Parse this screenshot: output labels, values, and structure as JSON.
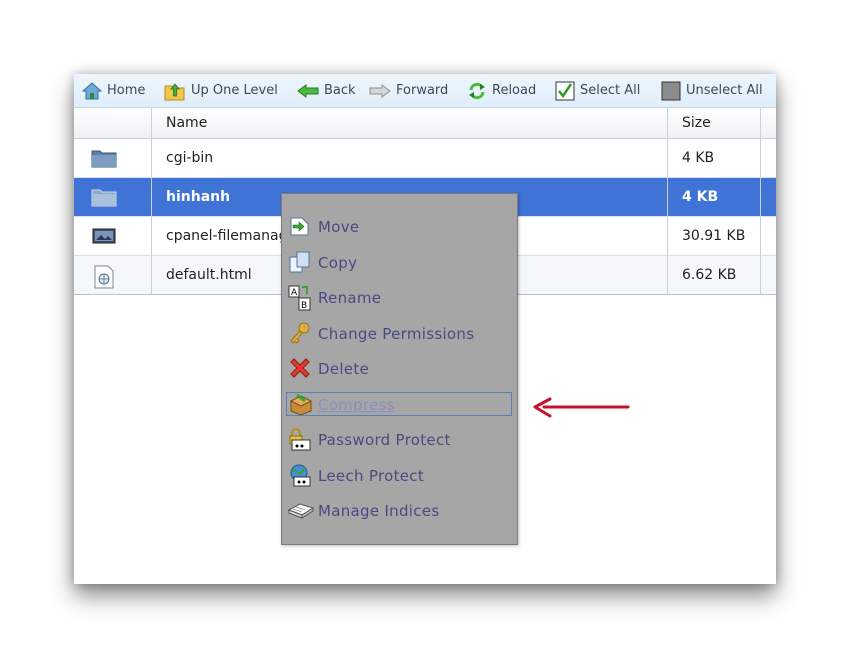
{
  "toolbar": {
    "home": "Home",
    "up": "Up One Level",
    "back": "Back",
    "forward": "Forward",
    "reload": "Reload",
    "select_all": "Select All",
    "unselect_all": "Unselect All"
  },
  "table": {
    "headers": {
      "name": "Name",
      "size": "Size"
    },
    "rows": [
      {
        "name": "cgi-bin",
        "size": "4 KB",
        "icon": "folder-icon"
      },
      {
        "name": "hinhanh",
        "size": "4 KB",
        "icon": "folder-icon",
        "selected": true
      },
      {
        "name": "cpanel-filemanag",
        "size": "30.91 KB",
        "icon": "image-file-icon"
      },
      {
        "name": "default.html",
        "size": "6.62 KB",
        "icon": "html-file-icon"
      }
    ]
  },
  "context_menu": {
    "items": [
      {
        "label": "Move",
        "icon": "move-icon"
      },
      {
        "label": "Copy",
        "icon": "copy-icon"
      },
      {
        "label": "Rename",
        "icon": "rename-icon"
      },
      {
        "label": "Change Permissions",
        "icon": "key-icon"
      },
      {
        "label": "Delete",
        "icon": "delete-icon"
      },
      {
        "label": "Compress",
        "icon": "compress-icon",
        "highlighted": true
      },
      {
        "label": "Password Protect",
        "icon": "password-protect-icon"
      },
      {
        "label": "Leech Protect",
        "icon": "leech-protect-icon"
      },
      {
        "label": "Manage Indices",
        "icon": "manage-indices-icon"
      }
    ]
  },
  "colors": {
    "selected_row": "#3f73d6",
    "menu_bg": "#a6a6a6",
    "menu_text": "#4a4a82",
    "annotation_arrow": "#c8102e"
  }
}
